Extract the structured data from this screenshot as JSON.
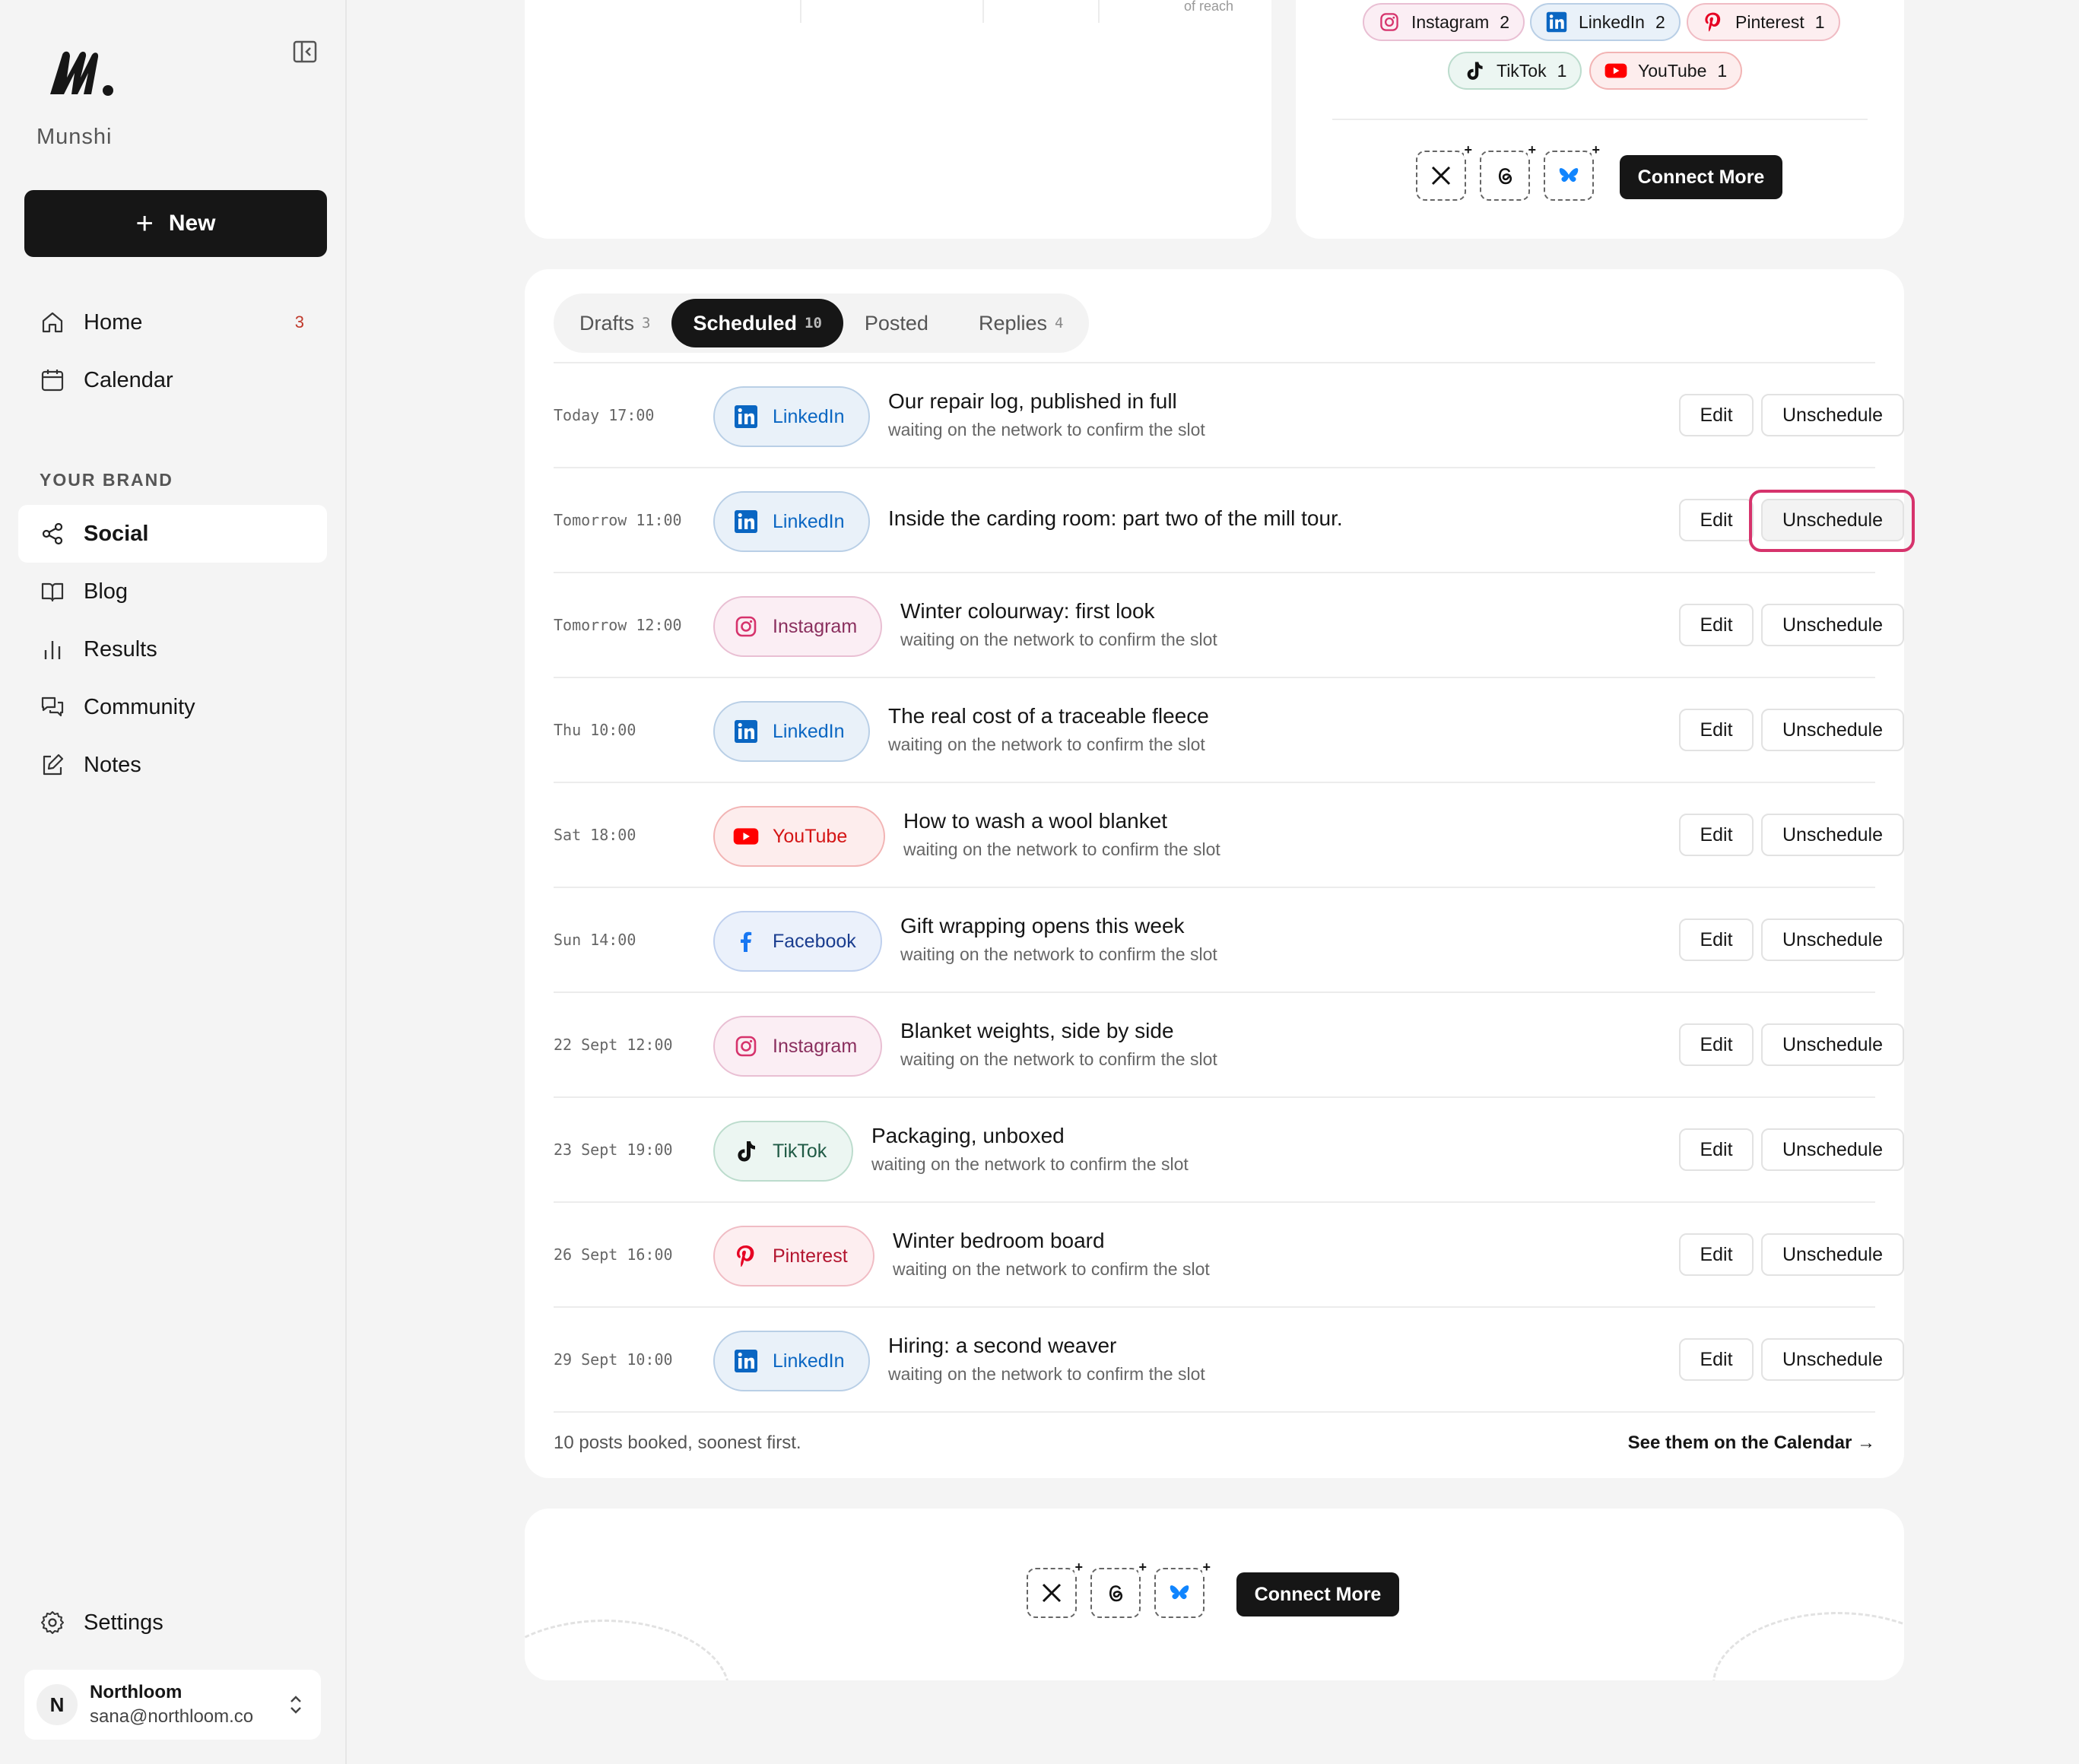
{
  "sidebar": {
    "brand": "Munshi",
    "new_label": "New",
    "nav": [
      {
        "label": "Home",
        "badge": "3"
      },
      {
        "label": "Calendar"
      }
    ],
    "section_label": "YOUR BRAND",
    "brand_nav": [
      {
        "label": "Social"
      },
      {
        "label": "Blog"
      },
      {
        "label": "Results"
      },
      {
        "label": "Community"
      },
      {
        "label": "Notes"
      }
    ],
    "settings_label": "Settings",
    "account": {
      "initial": "N",
      "name": "Northloom",
      "email": "sana@northloom.co"
    }
  },
  "top_left": {
    "reach_label": "of reach"
  },
  "top_right": {
    "chips": [
      {
        "network": "Instagram",
        "count": "2"
      },
      {
        "network": "LinkedIn",
        "count": "2"
      },
      {
        "network": "Pinterest",
        "count": "1"
      },
      {
        "network": "TikTok",
        "count": "1"
      },
      {
        "network": "YouTube",
        "count": "1"
      }
    ],
    "connect_label": "Connect More"
  },
  "tabs": [
    {
      "label": "Drafts",
      "count": "3"
    },
    {
      "label": "Scheduled",
      "count": "10"
    },
    {
      "label": "Posted",
      "count": ""
    },
    {
      "label": "Replies",
      "count": "4"
    }
  ],
  "posts": [
    {
      "time": "Today 17:00",
      "network": "LinkedIn",
      "title": "Our repair log, published in full",
      "status": "waiting on the network to confirm the slot"
    },
    {
      "time": "Tomorrow 11:00",
      "network": "LinkedIn",
      "title": "Inside the carding room: part two of the mill tour.",
      "status": ""
    },
    {
      "time": "Tomorrow 12:00",
      "network": "Instagram",
      "title": "Winter colourway: first look",
      "status": "waiting on the network to confirm the slot"
    },
    {
      "time": "Thu 10:00",
      "network": "LinkedIn",
      "title": "The real cost of a traceable fleece",
      "status": "waiting on the network to confirm the slot"
    },
    {
      "time": "Sat 18:00",
      "network": "YouTube",
      "title": "How to wash a wool blanket",
      "status": "waiting on the network to confirm the slot"
    },
    {
      "time": "Sun 14:00",
      "network": "Facebook",
      "title": "Gift wrapping opens this week",
      "status": "waiting on the network to confirm the slot"
    },
    {
      "time": "22 Sept 12:00",
      "network": "Instagram",
      "title": "Blanket weights, side by side",
      "status": "waiting on the network to confirm the slot"
    },
    {
      "time": "23 Sept 19:00",
      "network": "TikTok",
      "title": "Packaging, unboxed",
      "status": "waiting on the network to confirm the slot"
    },
    {
      "time": "26 Sept 16:00",
      "network": "Pinterest",
      "title": "Winter bedroom board",
      "status": "waiting on the network to confirm the slot"
    },
    {
      "time": "29 Sept 10:00",
      "network": "LinkedIn",
      "title": "Hiring: a second weaver",
      "status": "waiting on the network to confirm the slot"
    }
  ],
  "row_actions": {
    "edit": "Edit",
    "unschedule": "Unschedule"
  },
  "footer": {
    "summary": "10 posts booked, soonest first.",
    "calendar_link": "See them on the Calendar →"
  },
  "bottom": {
    "connect_label": "Connect More"
  },
  "colors": {
    "LinkedIn": {
      "bg": "#e9f1f9",
      "border": "#b9cfe6",
      "text": "#0a66c2"
    },
    "Instagram": {
      "bg": "#fbeef4",
      "border": "#e9bfd3",
      "text": "#8a2f5e"
    },
    "YouTube": {
      "bg": "#fdeded",
      "border": "#f2b4b4",
      "text": "#d41515"
    },
    "Facebook": {
      "bg": "#ebf1fb",
      "border": "#bfd0ee",
      "text": "#1a3d8f"
    },
    "TikTok": {
      "bg": "#ecf6f2",
      "border": "#bcdccd",
      "text": "#1f5a45"
    },
    "Pinterest": {
      "bg": "#fdeef0",
      "border": "#f0bcc4",
      "text": "#b3152f"
    },
    "focus": "#d6336c"
  }
}
